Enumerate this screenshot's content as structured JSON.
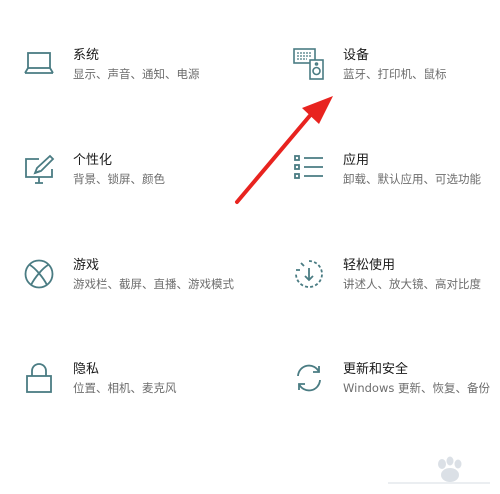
{
  "settings": {
    "tiles": [
      {
        "title": "系统",
        "desc": "显示、声音、通知、电源",
        "icon": "laptop-icon"
      },
      {
        "title": "设备",
        "desc": "蓝牙、打印机、鼠标",
        "icon": "devices-icon"
      },
      {
        "title": "个性化",
        "desc": "背景、锁屏、颜色",
        "icon": "personalization-icon"
      },
      {
        "title": "应用",
        "desc": "卸载、默认应用、可选功能",
        "icon": "apps-list-icon"
      },
      {
        "title": "游戏",
        "desc": "游戏栏、截屏、直播、游戏模式",
        "icon": "xbox-icon"
      },
      {
        "title": "轻松使用",
        "desc": "讲述人、放大镜、高对比度",
        "icon": "ease-of-access-icon"
      },
      {
        "title": "隐私",
        "desc": "位置、相机、麦克风",
        "icon": "lock-icon"
      },
      {
        "title": "更新和安全",
        "desc": "Windows 更新、恢复、备份",
        "icon": "sync-icon"
      }
    ]
  },
  "annotation": {
    "arrow_color": "#e8231f"
  },
  "colors": {
    "icon": "#4a7c83",
    "title": "#1a1a1a",
    "desc": "#6d6d6d"
  }
}
